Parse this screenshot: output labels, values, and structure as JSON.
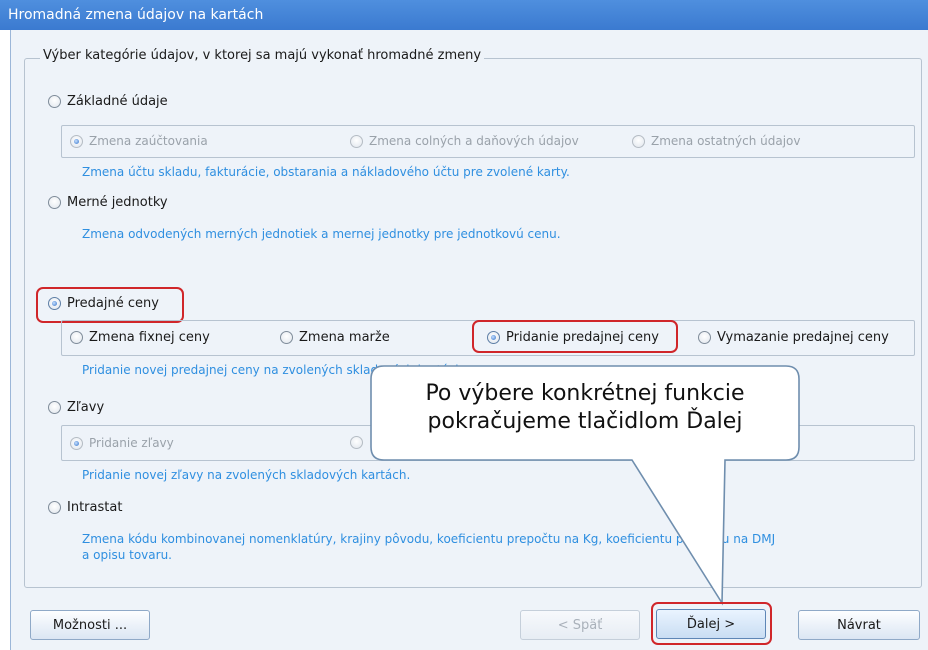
{
  "window": {
    "title": "Hromadná zmena údajov na kartách"
  },
  "group": {
    "title": "Výber kategórie údajov, v ktorej sa majú vykonať hromadné zmeny"
  },
  "categories": {
    "basic": {
      "label": "Základné údaje",
      "options": [
        "Zmena zaúčtovania",
        "Zmena colných a daňových údajov",
        "Zmena ostatných údajov"
      ],
      "description": "Zmena účtu skladu, fakturácie, obstarania a nákladového účtu pre zvolené karty."
    },
    "units": {
      "label": "Merné jednotky",
      "description": "Zmena odvodených merných jednotiek a mernej jednotky pre jednotkovú cenu."
    },
    "prices": {
      "label": "Predajné ceny",
      "options": [
        "Zmena fixnej ceny",
        "Zmena marže",
        "Pridanie predajnej ceny",
        "Vymazanie predajnej ceny"
      ],
      "description": "Pridanie novej predajnej ceny na zvolených skladových kartách."
    },
    "discounts": {
      "label": "Zľavy",
      "options": [
        "Pridanie zľavy"
      ],
      "description": "Pridanie novej zľavy na zvolených skladových kartách."
    },
    "intrastat": {
      "label": "Intrastat",
      "description_line1": "Zmena kódu kombinovanej nomenklatúry, krajiny pôvodu, koeficientu prepočtu na Kg, koeficientu prepočtu na DMJ",
      "description_line2": "a opisu tovaru."
    }
  },
  "buttons": {
    "options": "Možnosti ...",
    "back": "< Späť",
    "next": "Ďalej >",
    "return": "Návrat"
  },
  "callout": {
    "line1": "Po výbere konkrétnej funkcie",
    "line2": "pokračujeme tlačidlom Ďalej"
  },
  "colors": {
    "accent": "#2f8fe0",
    "highlight": "#d0262a",
    "titlebar": "#3b7ad0"
  }
}
